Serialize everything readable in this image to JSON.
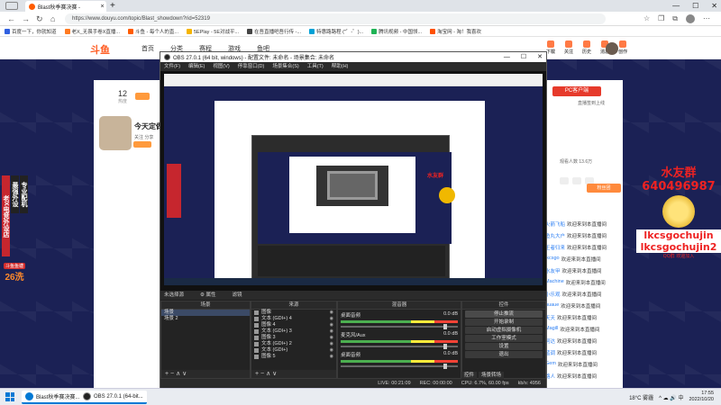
{
  "browser": {
    "tab_title": "Blast秋季赛决赛 -",
    "new_tab": "+",
    "window_controls": [
      "—",
      "☐",
      "✕"
    ],
    "url": "https://www.douyu.com/topic/Blast_showdown?rid=52319",
    "bookmarks": [
      "百度一下，你就知道",
      "老X_无畏手卷X直播...",
      "斗鱼 - 每个人的直...",
      "5EPlay - 5E对战平...",
      "在吾直播吧吾行传 -...",
      "特惠路路程 (\"゜-゜)...",
      "腾讯视频 - 中国领...",
      "淘宝网 - 淘！我喜欢"
    ]
  },
  "douyu": {
    "logo": "斗鱼",
    "nav": [
      "首页",
      "分类",
      "赛程",
      "游戏",
      "鱼吧"
    ],
    "header_right": [
      "下载",
      "关注",
      "历史",
      "消息",
      "创作"
    ],
    "room_num": "12",
    "room_sub": "热度",
    "room_title": "今天定做",
    "room_meta": "关注  分享",
    "pc_download": "PC客户端",
    "pc_sub": "直播签到上线",
    "chat_ttl": "观看人数 13.6万",
    "fan_btn": "粉丝团",
    "chat_lines": [
      {
        "user": "火箭飞船",
        "text": "欢迎来到本直播间"
      },
      {
        "user": "鱼丸大户",
        "text": "欢迎来到本直播间"
      },
      {
        "user": "王者归来",
        "text": "欢迎来到本直播间"
      },
      {
        "user": "lkcsgo",
        "text": "欢迎来到本直播间"
      },
      {
        "user": "水友甲",
        "text": "欢迎来到本直播间"
      },
      {
        "user": "Machine",
        "text": "欢迎来到本直播间"
      },
      {
        "user": "小乐观",
        "text": "欢迎来到本直播间"
      },
      {
        "user": "huaue",
        "text": "欢迎来到本直播间"
      },
      {
        "user": "天天",
        "text": "欢迎来到本直播间"
      },
      {
        "user": "Magill",
        "text": "欢迎来到本直播间"
      },
      {
        "user": "阿达",
        "text": "欢迎来到本直播间"
      },
      {
        "user": "蓝调",
        "text": "欢迎来到本直播间"
      },
      {
        "user": "Gem",
        "text": "欢迎来到本直播间"
      },
      {
        "user": "路人",
        "text": "欢迎来到本直播间"
      }
    ]
  },
  "ad": {
    "col1": "老X电竞外设店",
    "col2": "最强外设",
    "col3": "专业配机",
    "badge": "斗鱼鱼塘",
    "price": "26洗"
  },
  "overlay": {
    "title": "水友群",
    "number": "640496987",
    "name1": "lkcsgochujin",
    "name2": "lkcsgochujin2",
    "small": "QQ群  欢迎加入"
  },
  "obs": {
    "title": "OBS 27.0.1 (64 bit, windows) - 配置文件: 未命名 - 场景集合: 未命名",
    "menu": [
      "文件(F)",
      "编辑(E)",
      "视图(V)",
      "停靠窗口(D)",
      "场景集合(S)",
      "工具(T)",
      "帮助(H)"
    ],
    "status_row": [
      "未选择源",
      "⚙ 属性",
      "滤镜"
    ],
    "docks": {
      "scenes": {
        "title": "场景",
        "items": [
          "场景",
          "场景 2"
        ]
      },
      "sources": {
        "title": "来源",
        "items": [
          "图像",
          "文本 (GDI+) 4",
          "图像 4",
          "文本 (GDI+) 3",
          "图像 3",
          "文本 (GDI+) 2",
          "文本 (GDI+)",
          "图像 5"
        ]
      },
      "mixer": {
        "title": "混音器",
        "channels": [
          {
            "name": "桌面音频",
            "db": "0.0 dB"
          },
          {
            "name": "麦克风/Aux",
            "db": "0.0 dB"
          },
          {
            "name": "桌面音频",
            "db": "0.0 dB"
          }
        ]
      },
      "controls": {
        "title": "控件",
        "buttons": [
          "停止推流",
          "开始录制",
          "启动虚拟摄像机",
          "工作室模式",
          "设置",
          "退出"
        ]
      }
    },
    "bottom_tabs": [
      "控件",
      "场景转场"
    ],
    "statusbar": [
      "LIVE: 00:21:09",
      "REC: 00:00:00",
      "CPU: 6.7%, 60.00 fps",
      "kb/s: 4956"
    ],
    "foot": "+  −  ∧  ∨"
  },
  "taskbar": {
    "apps": [
      {
        "label": "Blast秋季赛决赛...",
        "color": "#0078d4"
      },
      {
        "label": "OBS 27.0.1 (64-bit...",
        "color": "#222222"
      }
    ],
    "weather": "18°C 雾霾",
    "tray_icons": "^  ☁  🔊  中",
    "time": "17:55",
    "date": "2022/10/20"
  }
}
